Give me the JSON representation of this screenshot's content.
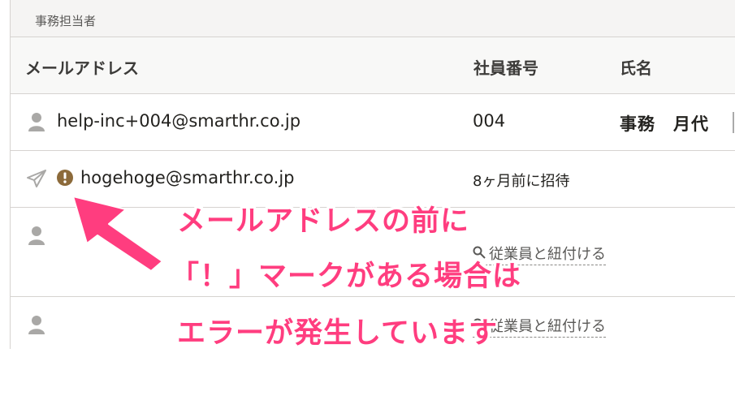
{
  "section": {
    "title": "事務担当者"
  },
  "columns": {
    "email": "メールアドレス",
    "employee_number": "社員番号",
    "name": "氏名"
  },
  "rows": [
    {
      "status": "person-icon",
      "email": "help-inc+004@smarthr.co.jp",
      "employee_number": "004",
      "name": "事務　月代"
    },
    {
      "status": "send-icon",
      "warning": "exclamation-icon",
      "email": "hogehoge@smarthr.co.jp",
      "invite_text": "8ヶ月前に招待"
    },
    {
      "status": "person-icon",
      "link_text": "従業員と紐付ける"
    },
    {
      "status": "person-icon",
      "link_text": "従業員と紐付ける"
    }
  ],
  "annotation": {
    "line1": "メールアドレスの前に",
    "line2": "「！」マークがある場合は",
    "line3": "エラーが発生しています",
    "color": "#ff3d7f"
  }
}
